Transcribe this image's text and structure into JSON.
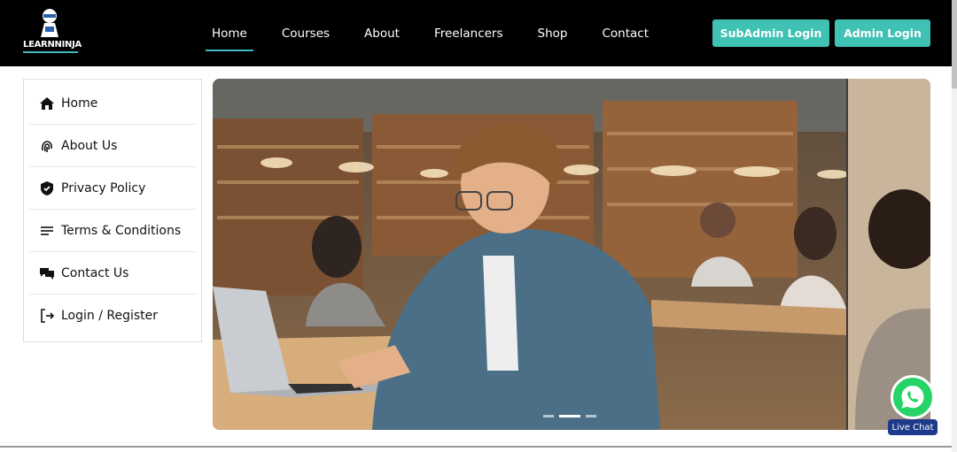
{
  "header": {
    "logo_text_main": "LEARNNINJA",
    "nav": [
      {
        "label": "Home"
      },
      {
        "label": "Courses"
      },
      {
        "label": "About"
      },
      {
        "label": "Freelancers"
      },
      {
        "label": "Shop"
      },
      {
        "label": "Contact"
      }
    ],
    "subadmin_label": "SubAdmin Login",
    "admin_label": "Admin Login"
  },
  "sidebar": {
    "items": [
      {
        "label": "Home",
        "icon": "home-icon"
      },
      {
        "label": "About Us",
        "icon": "fingerprint-icon"
      },
      {
        "label": "Privacy Policy",
        "icon": "shield-check-icon"
      },
      {
        "label": "Terms & Conditions",
        "icon": "menu-lines-icon"
      },
      {
        "label": "Contact Us",
        "icon": "chat-bubbles-icon"
      },
      {
        "label": "Login / Register",
        "icon": "login-icon"
      }
    ]
  },
  "hero": {
    "image": "student-laptop-library-photo",
    "slides": 3,
    "active_slide": 2
  },
  "chat": {
    "label": "Live Chat",
    "icon": "whatsapp-icon"
  },
  "colors": {
    "accent": "#3fc1b4",
    "topbar": "#000000",
    "chat_badge": "#1e3a8a",
    "whatsapp": "#25d366"
  }
}
